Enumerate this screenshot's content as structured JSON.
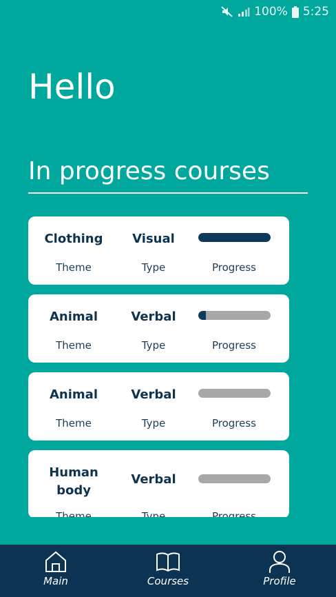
{
  "status_bar": {
    "battery_text": "100%",
    "time": "5:25",
    "icons": [
      "mute-icon",
      "signal-icon",
      "battery-icon"
    ]
  },
  "greeting": "Hello",
  "section_title": "In progress courses",
  "courses": [
    {
      "theme": "Clothing",
      "type": "Visual",
      "progress": 1.0,
      "theme_label": "Theme",
      "type_label": "Type",
      "progress_label": "Progress"
    },
    {
      "theme": "Animal",
      "type": "Verbal",
      "progress": 0.1,
      "theme_label": "Theme",
      "type_label": "Type",
      "progress_label": "Progress"
    },
    {
      "theme": "Animal",
      "type": "Verbal",
      "progress": 0.0,
      "theme_label": "Theme",
      "type_label": "Type",
      "progress_label": "Progress"
    },
    {
      "theme": "Human body",
      "type": "Verbal",
      "progress": 0.0,
      "theme_label": "Theme",
      "type_label": "Type",
      "progress_label": "Progress"
    }
  ],
  "nav": {
    "items": [
      {
        "label": "Main",
        "icon": "home-icon"
      },
      {
        "label": "Courses",
        "icon": "book-icon"
      },
      {
        "label": "Profile",
        "icon": "user-icon"
      }
    ]
  },
  "colors": {
    "background": "#00a79d",
    "card": "#ffffff",
    "text_dark": "#0d3350",
    "progress_fill": "#0d3a5b",
    "progress_track": "#a8a8a8",
    "nav_bar": "#0c3452"
  }
}
